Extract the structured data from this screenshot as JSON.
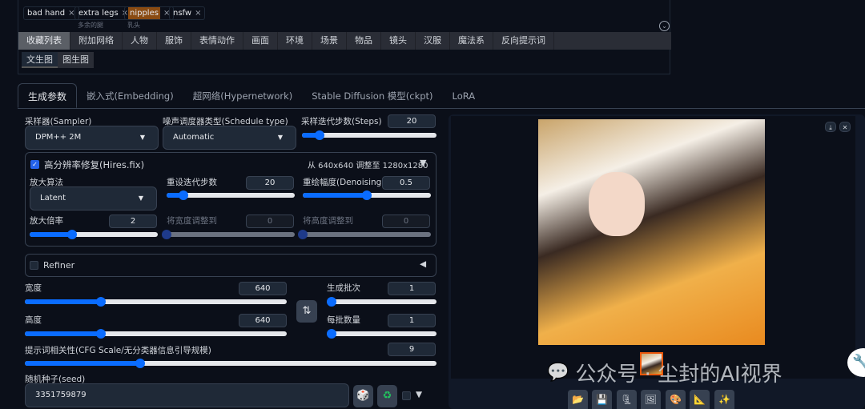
{
  "tags": [
    {
      "label": "bad hand",
      "sub": ""
    },
    {
      "label": "extra legs",
      "sub": "多余的腿"
    },
    {
      "label": "nipples",
      "sub": "乳头",
      "highlight": true
    },
    {
      "label": "nsfw",
      "sub": ""
    }
  ],
  "categories": [
    "收藏列表",
    "附加网络",
    "人物",
    "服饰",
    "表情动作",
    "画面",
    "环境",
    "场景",
    "物品",
    "镜头",
    "汉服",
    "魔法系",
    "反向提示词"
  ],
  "sub_tabs": [
    "文生图",
    "图生图"
  ],
  "tabs": [
    "生成参数",
    "嵌入式(Embedding)",
    "超网络(Hypernetwork)",
    "Stable Diffusion 模型(ckpt)",
    "LoRA"
  ],
  "sampler": {
    "label": "采样器(Sampler)",
    "value": "DPM++ 2M"
  },
  "schedule": {
    "label": "噪声调度器类型(Schedule type)",
    "value": "Automatic"
  },
  "steps": {
    "label": "采样迭代步数(Steps)",
    "value": "20",
    "fraction": 0.13
  },
  "hires": {
    "label": "高分辨率修复(Hires.fix)",
    "checked": true,
    "summary": "从 640x640 调整至 1280x1280",
    "toggle": "▼",
    "upscaler": {
      "label": "放大算法",
      "value": "Latent"
    },
    "steps": {
      "label": "重设迭代步数",
      "value": "20",
      "fraction": 0.13
    },
    "denoising": {
      "label": "重绘幅度(Denoising)",
      "value": "0.5",
      "fraction": 0.5
    },
    "scale": {
      "label": "放大倍率",
      "value": "2",
      "fraction": 0.33
    },
    "resize_w": {
      "label": "将宽度调整到",
      "value": "0",
      "fraction": 0
    },
    "resize_h": {
      "label": "将高度调整到",
      "value": "0",
      "fraction": 0
    }
  },
  "refiner": {
    "label": "Refiner",
    "checked": false,
    "toggle": "◀"
  },
  "width": {
    "label": "宽度",
    "value": "640",
    "fraction": 0.29
  },
  "height": {
    "label": "高度",
    "value": "640",
    "fraction": 0.29
  },
  "swap_icon": "⇅",
  "batch_count": {
    "label": "生成批次",
    "value": "1",
    "fraction": 0
  },
  "batch_size": {
    "label": "每批数量",
    "value": "1",
    "fraction": 0
  },
  "cfg": {
    "label": "提示词相关性(CFG Scale/无分类器信息引导规模)",
    "value": "9",
    "fraction": 0.28
  },
  "seed": {
    "label": "随机种子(seed)",
    "value": "3351759879"
  },
  "seed_toggle": "▼",
  "watermark": "公众号 · 尘封的AI视界",
  "colors": {
    "accent": "#0a6cff",
    "background": "#0b0f19",
    "highlight_tag": "#8a4b12"
  }
}
